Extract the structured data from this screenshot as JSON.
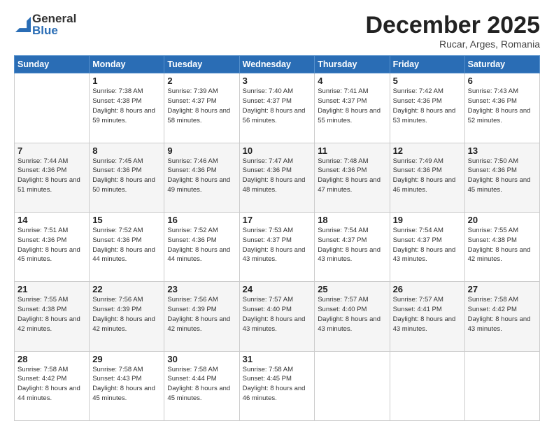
{
  "logo": {
    "general": "General",
    "blue": "Blue"
  },
  "header": {
    "month": "December 2025",
    "location": "Rucar, Arges, Romania"
  },
  "weekdays": [
    "Sunday",
    "Monday",
    "Tuesday",
    "Wednesday",
    "Thursday",
    "Friday",
    "Saturday"
  ],
  "weeks": [
    [
      {
        "day": "",
        "sunrise": "",
        "sunset": "",
        "daylight": ""
      },
      {
        "day": "1",
        "sunrise": "Sunrise: 7:38 AM",
        "sunset": "Sunset: 4:38 PM",
        "daylight": "Daylight: 8 hours and 59 minutes."
      },
      {
        "day": "2",
        "sunrise": "Sunrise: 7:39 AM",
        "sunset": "Sunset: 4:37 PM",
        "daylight": "Daylight: 8 hours and 58 minutes."
      },
      {
        "day": "3",
        "sunrise": "Sunrise: 7:40 AM",
        "sunset": "Sunset: 4:37 PM",
        "daylight": "Daylight: 8 hours and 56 minutes."
      },
      {
        "day": "4",
        "sunrise": "Sunrise: 7:41 AM",
        "sunset": "Sunset: 4:37 PM",
        "daylight": "Daylight: 8 hours and 55 minutes."
      },
      {
        "day": "5",
        "sunrise": "Sunrise: 7:42 AM",
        "sunset": "Sunset: 4:36 PM",
        "daylight": "Daylight: 8 hours and 53 minutes."
      },
      {
        "day": "6",
        "sunrise": "Sunrise: 7:43 AM",
        "sunset": "Sunset: 4:36 PM",
        "daylight": "Daylight: 8 hours and 52 minutes."
      }
    ],
    [
      {
        "day": "7",
        "sunrise": "Sunrise: 7:44 AM",
        "sunset": "Sunset: 4:36 PM",
        "daylight": "Daylight: 8 hours and 51 minutes."
      },
      {
        "day": "8",
        "sunrise": "Sunrise: 7:45 AM",
        "sunset": "Sunset: 4:36 PM",
        "daylight": "Daylight: 8 hours and 50 minutes."
      },
      {
        "day": "9",
        "sunrise": "Sunrise: 7:46 AM",
        "sunset": "Sunset: 4:36 PM",
        "daylight": "Daylight: 8 hours and 49 minutes."
      },
      {
        "day": "10",
        "sunrise": "Sunrise: 7:47 AM",
        "sunset": "Sunset: 4:36 PM",
        "daylight": "Daylight: 8 hours and 48 minutes."
      },
      {
        "day": "11",
        "sunrise": "Sunrise: 7:48 AM",
        "sunset": "Sunset: 4:36 PM",
        "daylight": "Daylight: 8 hours and 47 minutes."
      },
      {
        "day": "12",
        "sunrise": "Sunrise: 7:49 AM",
        "sunset": "Sunset: 4:36 PM",
        "daylight": "Daylight: 8 hours and 46 minutes."
      },
      {
        "day": "13",
        "sunrise": "Sunrise: 7:50 AM",
        "sunset": "Sunset: 4:36 PM",
        "daylight": "Daylight: 8 hours and 45 minutes."
      }
    ],
    [
      {
        "day": "14",
        "sunrise": "Sunrise: 7:51 AM",
        "sunset": "Sunset: 4:36 PM",
        "daylight": "Daylight: 8 hours and 45 minutes."
      },
      {
        "day": "15",
        "sunrise": "Sunrise: 7:52 AM",
        "sunset": "Sunset: 4:36 PM",
        "daylight": "Daylight: 8 hours and 44 minutes."
      },
      {
        "day": "16",
        "sunrise": "Sunrise: 7:52 AM",
        "sunset": "Sunset: 4:36 PM",
        "daylight": "Daylight: 8 hours and 44 minutes."
      },
      {
        "day": "17",
        "sunrise": "Sunrise: 7:53 AM",
        "sunset": "Sunset: 4:37 PM",
        "daylight": "Daylight: 8 hours and 43 minutes."
      },
      {
        "day": "18",
        "sunrise": "Sunrise: 7:54 AM",
        "sunset": "Sunset: 4:37 PM",
        "daylight": "Daylight: 8 hours and 43 minutes."
      },
      {
        "day": "19",
        "sunrise": "Sunrise: 7:54 AM",
        "sunset": "Sunset: 4:37 PM",
        "daylight": "Daylight: 8 hours and 43 minutes."
      },
      {
        "day": "20",
        "sunrise": "Sunrise: 7:55 AM",
        "sunset": "Sunset: 4:38 PM",
        "daylight": "Daylight: 8 hours and 42 minutes."
      }
    ],
    [
      {
        "day": "21",
        "sunrise": "Sunrise: 7:55 AM",
        "sunset": "Sunset: 4:38 PM",
        "daylight": "Daylight: 8 hours and 42 minutes."
      },
      {
        "day": "22",
        "sunrise": "Sunrise: 7:56 AM",
        "sunset": "Sunset: 4:39 PM",
        "daylight": "Daylight: 8 hours and 42 minutes."
      },
      {
        "day": "23",
        "sunrise": "Sunrise: 7:56 AM",
        "sunset": "Sunset: 4:39 PM",
        "daylight": "Daylight: 8 hours and 42 minutes."
      },
      {
        "day": "24",
        "sunrise": "Sunrise: 7:57 AM",
        "sunset": "Sunset: 4:40 PM",
        "daylight": "Daylight: 8 hours and 43 minutes."
      },
      {
        "day": "25",
        "sunrise": "Sunrise: 7:57 AM",
        "sunset": "Sunset: 4:40 PM",
        "daylight": "Daylight: 8 hours and 43 minutes."
      },
      {
        "day": "26",
        "sunrise": "Sunrise: 7:57 AM",
        "sunset": "Sunset: 4:41 PM",
        "daylight": "Daylight: 8 hours and 43 minutes."
      },
      {
        "day": "27",
        "sunrise": "Sunrise: 7:58 AM",
        "sunset": "Sunset: 4:42 PM",
        "daylight": "Daylight: 8 hours and 43 minutes."
      }
    ],
    [
      {
        "day": "28",
        "sunrise": "Sunrise: 7:58 AM",
        "sunset": "Sunset: 4:42 PM",
        "daylight": "Daylight: 8 hours and 44 minutes."
      },
      {
        "day": "29",
        "sunrise": "Sunrise: 7:58 AM",
        "sunset": "Sunset: 4:43 PM",
        "daylight": "Daylight: 8 hours and 45 minutes."
      },
      {
        "day": "30",
        "sunrise": "Sunrise: 7:58 AM",
        "sunset": "Sunset: 4:44 PM",
        "daylight": "Daylight: 8 hours and 45 minutes."
      },
      {
        "day": "31",
        "sunrise": "Sunrise: 7:58 AM",
        "sunset": "Sunset: 4:45 PM",
        "daylight": "Daylight: 8 hours and 46 minutes."
      },
      {
        "day": "",
        "sunrise": "",
        "sunset": "",
        "daylight": ""
      },
      {
        "day": "",
        "sunrise": "",
        "sunset": "",
        "daylight": ""
      },
      {
        "day": "",
        "sunrise": "",
        "sunset": "",
        "daylight": ""
      }
    ]
  ]
}
